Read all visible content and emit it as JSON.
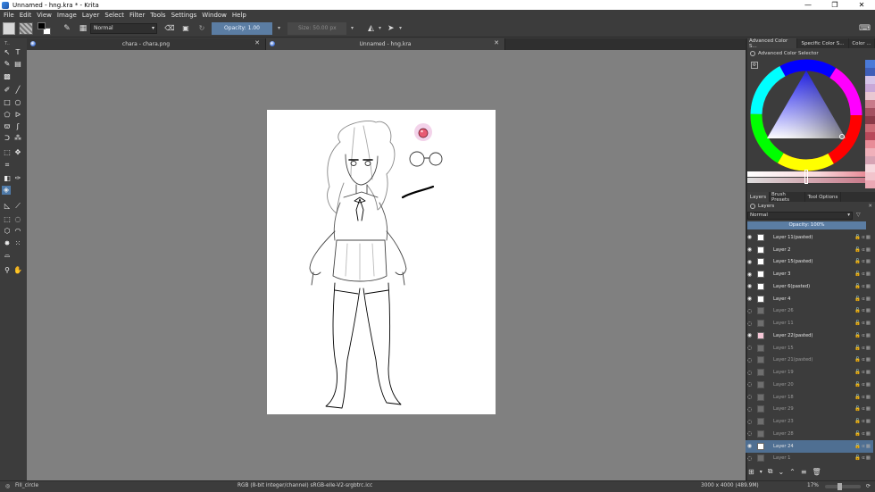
{
  "window": {
    "title": "Unnamed - hng.kra * - Krita",
    "minimize": "—",
    "maximize": "❐",
    "close": "✕"
  },
  "menu": [
    "File",
    "Edit",
    "View",
    "Image",
    "Layer",
    "Select",
    "Filter",
    "Tools",
    "Settings",
    "Window",
    "Help"
  ],
  "toolbar": {
    "blend_mode": "Normal",
    "opacity_label": "Opacity: 1.00",
    "size_label": "Size: 50.00 px",
    "colors": {
      "foreground": "#000000",
      "background": "#ffffff",
      "opacity_highlight": "#5b7da3"
    }
  },
  "tabs": [
    {
      "label": "chara - chara.png",
      "close": "✕",
      "active": false
    },
    {
      "label": "Unnamed - hng.kra",
      "close": "✕",
      "active": true
    }
  ],
  "right_dock": {
    "top_tabs": [
      "Advanced Color S...",
      "Specific Color S...",
      "Color ..."
    ],
    "color_selector_title": "Advanced Color Selector",
    "layer_tabs": [
      "Layers",
      "Brush Presets",
      "Tool Options"
    ],
    "layers_title": "Layers",
    "blend_mode": "Normal",
    "opacity_label": "Opacity: 100%",
    "layers": [
      {
        "name": "Layer 11(pasted)",
        "visible": true,
        "selected": false
      },
      {
        "name": "Layer 2",
        "visible": true,
        "selected": false
      },
      {
        "name": "Layer 15(pasted)",
        "visible": true,
        "selected": false
      },
      {
        "name": "Layer 3",
        "visible": true,
        "selected": false
      },
      {
        "name": "Layer 6(pasted)",
        "visible": true,
        "selected": false
      },
      {
        "name": "Layer 4",
        "visible": true,
        "selected": false
      },
      {
        "name": "Layer 26",
        "visible": false,
        "selected": false
      },
      {
        "name": "Layer 11",
        "visible": false,
        "selected": false
      },
      {
        "name": "Layer 22(pasted)",
        "visible": true,
        "selected": false
      },
      {
        "name": "Layer 15",
        "visible": false,
        "selected": false
      },
      {
        "name": "Layer 21(pasted)",
        "visible": false,
        "selected": false
      },
      {
        "name": "Layer 19",
        "visible": false,
        "selected": false
      },
      {
        "name": "Layer 20",
        "visible": false,
        "selected": false
      },
      {
        "name": "Layer 18",
        "visible": false,
        "selected": false
      },
      {
        "name": "Layer 29",
        "visible": false,
        "selected": false
      },
      {
        "name": "Layer 23",
        "visible": false,
        "selected": false
      },
      {
        "name": "Layer 28",
        "visible": false,
        "selected": false
      },
      {
        "name": "Layer 24",
        "visible": true,
        "selected": true
      },
      {
        "name": "Layer 1",
        "visible": false,
        "selected": false
      }
    ],
    "palette_colors": [
      "#4a7ad8",
      "#3f5fb8",
      "#d6c5e9",
      "#c8a8d8",
      "#e9c8d2",
      "#c97a8a",
      "#a35060",
      "#8a3a48",
      "#cc6b76",
      "#b8485a",
      "#e88c98",
      "#f0b0ba",
      "#d6a3b4",
      "#f6d8de",
      "#f2c4cc",
      "#eba8b4"
    ]
  },
  "status": {
    "tool": "Fill_circle",
    "color_info": "RGB (8-bit integer/channel)  sRGB-elle-V2-srgbtrc.icc",
    "dimensions": "3000 x 4000 (489.9M)",
    "zoom": "17%"
  }
}
